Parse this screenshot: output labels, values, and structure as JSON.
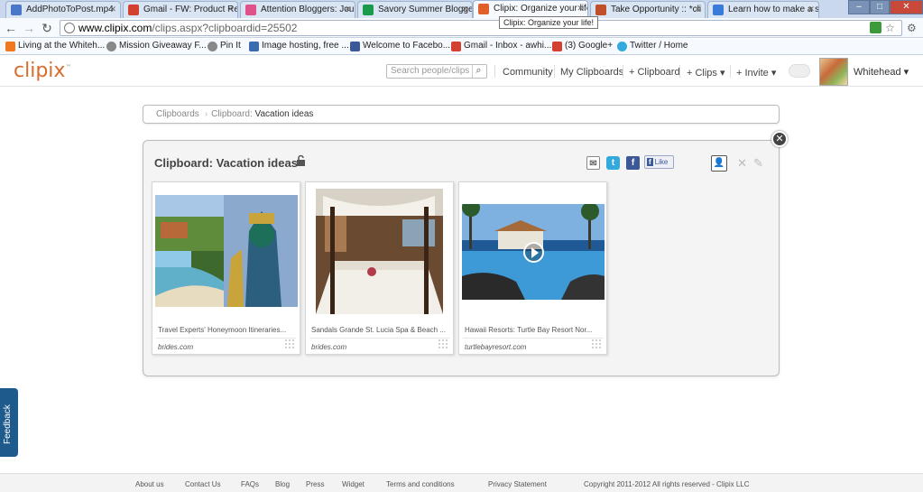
{
  "browser": {
    "tabs": [
      {
        "title": "AddPhotoToPost.mp4",
        "favicon_color": "#4a78c8",
        "active": false
      },
      {
        "title": "Gmail - FW: Product Re",
        "favicon_color": "#d44030",
        "active": false
      },
      {
        "title": "Attention Bloggers: Jou",
        "favicon_color": "#e0508a",
        "active": false
      },
      {
        "title": "Savory Summer Blogge",
        "favicon_color": "#1b9a4b",
        "active": false
      },
      {
        "title": "Clipix: Organize your life",
        "favicon_color": "#e0602a",
        "active": true
      },
      {
        "title": "Take Opportunity :: *cli",
        "favicon_color": "#c0502a",
        "active": false
      },
      {
        "title": "Learn how to make a sc",
        "favicon_color": "#3a7ad8",
        "active": false
      }
    ],
    "tab_close": "✕",
    "tooltip": "Clipix: Organize your life!",
    "url_host": "www.clipix.com",
    "url_path": "/clips.aspx?clipboardid=25502",
    "window_controls": {
      "minimize": "–",
      "maximize": "□",
      "close": "✕"
    },
    "bookmarks": [
      {
        "label": "Living at the Whiteh...",
        "icon_color": "#f07820"
      },
      {
        "label": "Mission Giveaway F...",
        "icon_color": "#777777"
      },
      {
        "label": "Pin It",
        "icon_color": "#777777"
      },
      {
        "label": "Image hosting, free ...",
        "icon_color": "#3a6ab0"
      },
      {
        "label": "Welcome to Facebo...",
        "icon_color": "#3b5998"
      },
      {
        "label": "Gmail - Inbox - awhi...",
        "icon_color": "#d44030"
      },
      {
        "label": "(3) Google+",
        "icon_color": "#d44030"
      },
      {
        "label": "Twitter / Home",
        "icon_color": "#33aadd"
      }
    ]
  },
  "site": {
    "logo": "clipix",
    "logo_tm": "™",
    "search_placeholder": "Search people/clips",
    "nav": [
      "Community",
      "My Clipboards",
      "+ Clipboard",
      "+ Clips ▾",
      "+ Invite ▾"
    ],
    "username": "Whitehead ▾"
  },
  "breadcrumb": {
    "root": "Clipboards",
    "label": "Clipboard:",
    "current": "Vacation ideas"
  },
  "clipboard": {
    "title": "Clipboard: Vacation ideas",
    "fb_like": "Like",
    "clips": [
      {
        "caption": "Travel Experts' Honeymoon Itineraries...",
        "source": "brides.com",
        "has_video": false
      },
      {
        "caption": "Sandals Grande St. Lucia Spa & Beach ...",
        "source": "brides.com",
        "has_video": false
      },
      {
        "caption": "Hawaii Resorts: Turtle Bay Resort Nor...",
        "source": "turtlebayresort.com",
        "has_video": true
      }
    ]
  },
  "feedback": "Feedback",
  "footer": [
    "About us",
    "Contact Us",
    "FAQs",
    "Blog",
    "Press",
    "Widget",
    "Terms and conditions",
    "Privacy Statement",
    "Copyright 2011-2012 All rights reserved - Clipix LLC"
  ]
}
